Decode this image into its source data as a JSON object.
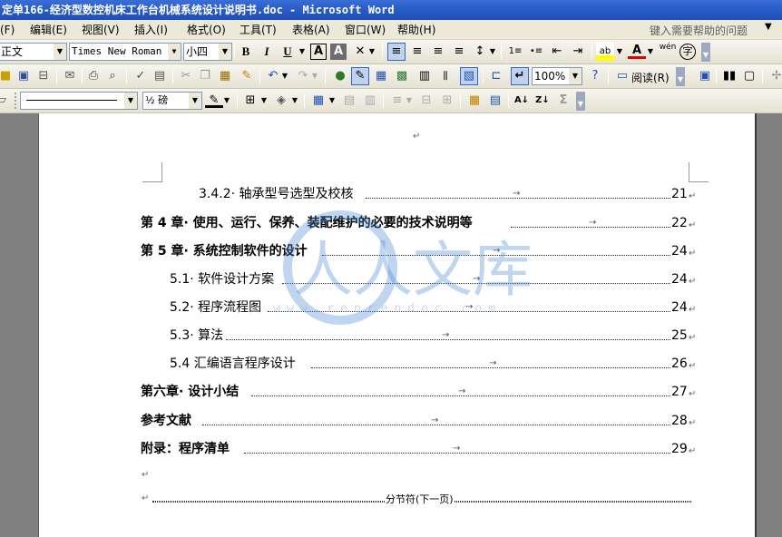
{
  "window": {
    "title": "定单166-经济型数控机床工作台机械系统设计说明书.doc - Microsoft Word"
  },
  "menubar": {
    "items": [
      {
        "label": "(F)"
      },
      {
        "label": "编辑(E)"
      },
      {
        "label": "视图(V)"
      },
      {
        "label": "插入(I)"
      },
      {
        "label": "格式(O)"
      },
      {
        "label": "工具(T)"
      },
      {
        "label": "表格(A)"
      },
      {
        "label": "窗口(W)"
      },
      {
        "label": "帮助(H)"
      }
    ],
    "help_placeholder": "键入需要帮助的问题"
  },
  "formatting_toolbar": {
    "style": "正文",
    "font": "Times New Roman",
    "size": "小四",
    "buttons": {
      "bold": "B",
      "italic": "I",
      "underline": "U",
      "char_border": "A",
      "char_shade": "A",
      "align_left": "≡",
      "center": "≡",
      "align_right": "≡",
      "justify": "≡",
      "line_spacing": "↕",
      "numbering": "1≡",
      "bullets": "•≡",
      "decrease_indent": "⇤",
      "increase_indent": "⇥",
      "highlight": "ab",
      "font_color": "A",
      "phonetic": "wén",
      "enclose": "字"
    }
  },
  "standard_toolbar": {
    "zoom": "100%",
    "read_label": "阅读(R)"
  },
  "tables_borders_toolbar": {
    "border_weight": "½ 磅",
    "autosum": "Σ"
  },
  "document": {
    "toc": [
      {
        "title": "3.4.2· 轴承型号选型及校核",
        "page": "21",
        "bold": false
      },
      {
        "title": "第 4 章· 使用、运行、保养、装配维护的必要的技术说明等",
        "page": "22",
        "bold": true
      },
      {
        "title": "第 5 章· 系统控制软件的设计",
        "page": "24",
        "bold": true
      },
      {
        "title": "5.1· 软件设计方案",
        "page": "24",
        "bold": false
      },
      {
        "title": "5.2· 程序流程图",
        "page": "24",
        "bold": false
      },
      {
        "title": "5.3· 算法",
        "page": "25",
        "bold": false
      },
      {
        "title": "5.4 汇编语言程序设计",
        "page": "26",
        "bold": false
      },
      {
        "title": "第六章· 设计小结",
        "page": "27",
        "bold": true
      },
      {
        "title": "参考文献",
        "page": "28",
        "bold": true
      },
      {
        "title": "附录：程序清单",
        "page": "29",
        "bold": true
      }
    ],
    "paragraph_mark": "↵",
    "tab_mark": "→",
    "section_break_label": "分节符(下一页)"
  },
  "watermark": {
    "text": "人人文库",
    "url": "www.renrendoc.com",
    "color": "#4a8ad4"
  }
}
